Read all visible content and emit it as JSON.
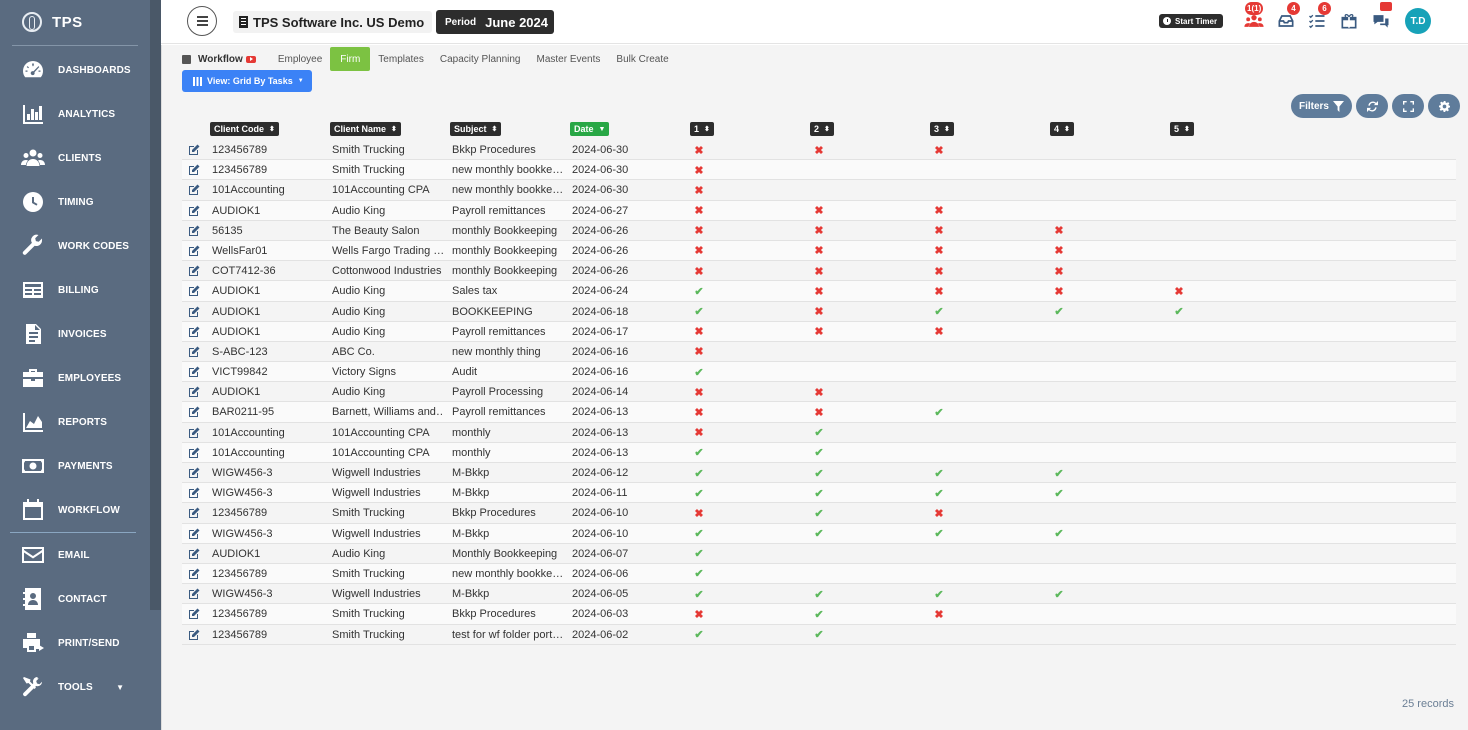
{
  "sidebar": {
    "brand": "TPS",
    "items": [
      {
        "label": "DASHBOARDS",
        "icon": "dashboard-icon"
      },
      {
        "label": "ANALYTICS",
        "icon": "bar-chart-icon"
      },
      {
        "label": "CLIENTS",
        "icon": "users-icon"
      },
      {
        "label": "TIMING",
        "icon": "clock-icon"
      },
      {
        "label": "WORK CODES",
        "icon": "wrench-icon"
      },
      {
        "label": "BILLING",
        "icon": "billing-icon"
      },
      {
        "label": "INVOICES",
        "icon": "invoice-icon"
      },
      {
        "label": "EMPLOYEES",
        "icon": "briefcase-icon"
      },
      {
        "label": "REPORTS",
        "icon": "area-chart-icon"
      },
      {
        "label": "PAYMENTS",
        "icon": "money-icon"
      },
      {
        "label": "WORKFLOW",
        "icon": "calendar-icon"
      },
      {
        "label": "EMAIL",
        "icon": "envelope-icon"
      },
      {
        "label": "CONTACT",
        "icon": "contact-card-icon"
      },
      {
        "label": "PRINT/SEND",
        "icon": "print-send-icon"
      },
      {
        "label": "TOOLS",
        "icon": "tools-icon"
      }
    ]
  },
  "header": {
    "company": "TPS Software Inc. US Demo",
    "period_label": "Period",
    "period_value": "June 2024",
    "start_timer": "Start Timer",
    "badges": {
      "users": "1(1)",
      "inbox": "4",
      "tasks": "6"
    },
    "avatar": "T.D"
  },
  "tabs": {
    "workflow": "Workflow",
    "items": [
      "Employee",
      "Firm",
      "Templates",
      "Capacity Planning",
      "Master Events",
      "Bulk Create"
    ],
    "active": "Firm"
  },
  "view_button": "View: Grid By Tasks",
  "toolbar": {
    "filters": "Filters"
  },
  "table": {
    "columns": [
      "Client Code",
      "Client Name",
      "Subject",
      "Date",
      "1",
      "2",
      "3",
      "4",
      "5"
    ],
    "sorted_column": "Date",
    "rows": [
      {
        "code": "123456789",
        "name": "Smith Trucking",
        "subject": "Bkkp Procedures",
        "date": "2024-06-30",
        "tasks": [
          "x",
          "x",
          "x",
          "",
          ""
        ]
      },
      {
        "code": "123456789",
        "name": "Smith Trucking",
        "subject": "new monthly bookke…",
        "date": "2024-06-30",
        "tasks": [
          "x",
          "",
          "",
          "",
          ""
        ]
      },
      {
        "code": "101Accounting",
        "name": "101Accounting CPA",
        "subject": "new monthly bookke…",
        "date": "2024-06-30",
        "tasks": [
          "x",
          "",
          "",
          "",
          ""
        ]
      },
      {
        "code": "AUDIOK1",
        "name": "Audio King",
        "subject": "Payroll remittances",
        "date": "2024-06-27",
        "tasks": [
          "x",
          "x",
          "x",
          "",
          ""
        ]
      },
      {
        "code": "56135",
        "name": "The Beauty Salon",
        "subject": "monthly Bookkeeping",
        "date": "2024-06-26",
        "tasks": [
          "x",
          "x",
          "x",
          "x",
          ""
        ]
      },
      {
        "code": "WellsFar01",
        "name": "Wells Fargo Trading …",
        "subject": "monthly Bookkeeping",
        "date": "2024-06-26",
        "tasks": [
          "x",
          "x",
          "x",
          "x",
          ""
        ]
      },
      {
        "code": "COT7412-36",
        "name": "Cottonwood Industries",
        "subject": "monthly Bookkeeping",
        "date": "2024-06-26",
        "tasks": [
          "x",
          "x",
          "x",
          "x",
          ""
        ]
      },
      {
        "code": "AUDIOK1",
        "name": "Audio King",
        "subject": "Sales tax",
        "date": "2024-06-24",
        "tasks": [
          "ok",
          "x",
          "x",
          "x",
          "x"
        ]
      },
      {
        "code": "AUDIOK1",
        "name": "Audio King",
        "subject": "BOOKKEEPING",
        "date": "2024-06-18",
        "tasks": [
          "ok",
          "x",
          "ok",
          "ok",
          "ok"
        ]
      },
      {
        "code": "AUDIOK1",
        "name": "Audio King",
        "subject": "Payroll remittances",
        "date": "2024-06-17",
        "tasks": [
          "x",
          "x",
          "x",
          "",
          ""
        ]
      },
      {
        "code": "S-ABC-123",
        "name": "ABC Co.",
        "subject": "new monthly thing",
        "date": "2024-06-16",
        "tasks": [
          "x",
          "",
          "",
          "",
          ""
        ]
      },
      {
        "code": "VICT99842",
        "name": "Victory Signs",
        "subject": "Audit",
        "date": "2024-06-16",
        "tasks": [
          "ok",
          "",
          "",
          "",
          ""
        ]
      },
      {
        "code": "AUDIOK1",
        "name": "Audio King",
        "subject": "Payroll Processing",
        "date": "2024-06-14",
        "tasks": [
          "x",
          "x",
          "",
          "",
          ""
        ]
      },
      {
        "code": "BAR0211-95",
        "name": "Barnett, Williams and…",
        "subject": "Payroll remittances",
        "date": "2024-06-13",
        "tasks": [
          "x",
          "x",
          "ok",
          "",
          ""
        ]
      },
      {
        "code": "101Accounting",
        "name": "101Accounting CPA",
        "subject": "monthly",
        "date": "2024-06-13",
        "tasks": [
          "x",
          "ok",
          "",
          "",
          ""
        ]
      },
      {
        "code": "101Accounting",
        "name": "101Accounting CPA",
        "subject": "monthly",
        "date": "2024-06-13",
        "tasks": [
          "ok",
          "ok",
          "",
          "",
          ""
        ]
      },
      {
        "code": "WIGW456-3",
        "name": "Wigwell Industries",
        "subject": "M-Bkkp",
        "date": "2024-06-12",
        "tasks": [
          "ok",
          "ok",
          "ok",
          "ok",
          ""
        ]
      },
      {
        "code": "WIGW456-3",
        "name": "Wigwell Industries",
        "subject": "M-Bkkp",
        "date": "2024-06-11",
        "tasks": [
          "ok",
          "ok",
          "ok",
          "ok",
          ""
        ]
      },
      {
        "code": "123456789",
        "name": "Smith Trucking",
        "subject": "Bkkp Procedures",
        "date": "2024-06-10",
        "tasks": [
          "x",
          "ok",
          "x",
          "",
          ""
        ]
      },
      {
        "code": "WIGW456-3",
        "name": "Wigwell Industries",
        "subject": "M-Bkkp",
        "date": "2024-06-10",
        "tasks": [
          "ok",
          "ok",
          "ok",
          "ok",
          ""
        ]
      },
      {
        "code": "AUDIOK1",
        "name": "Audio King",
        "subject": "Monthly Bookkeeping",
        "date": "2024-06-07",
        "tasks": [
          "ok",
          "",
          "",
          "",
          ""
        ]
      },
      {
        "code": "123456789",
        "name": "Smith Trucking",
        "subject": "new monthly bookke…",
        "date": "2024-06-06",
        "tasks": [
          "ok",
          "",
          "",
          "",
          ""
        ]
      },
      {
        "code": "WIGW456-3",
        "name": "Wigwell Industries",
        "subject": "M-Bkkp",
        "date": "2024-06-05",
        "tasks": [
          "ok",
          "ok",
          "ok",
          "ok",
          ""
        ]
      },
      {
        "code": "123456789",
        "name": "Smith Trucking",
        "subject": "Bkkp Procedures",
        "date": "2024-06-03",
        "tasks": [
          "x",
          "ok",
          "x",
          "",
          ""
        ]
      },
      {
        "code": "123456789",
        "name": "Smith Trucking",
        "subject": "test for wf folder port…",
        "date": "2024-06-02",
        "tasks": [
          "ok",
          "ok",
          "",
          "",
          ""
        ]
      }
    ]
  },
  "footer": {
    "records": "25 records"
  },
  "colors": {
    "sidebar": "#5a6b80",
    "active_tab": "#7cc242",
    "view_button": "#3b82f6",
    "x_mark": "#e53935",
    "check_mark": "#5cb85c",
    "avatar": "#17a2b8"
  }
}
